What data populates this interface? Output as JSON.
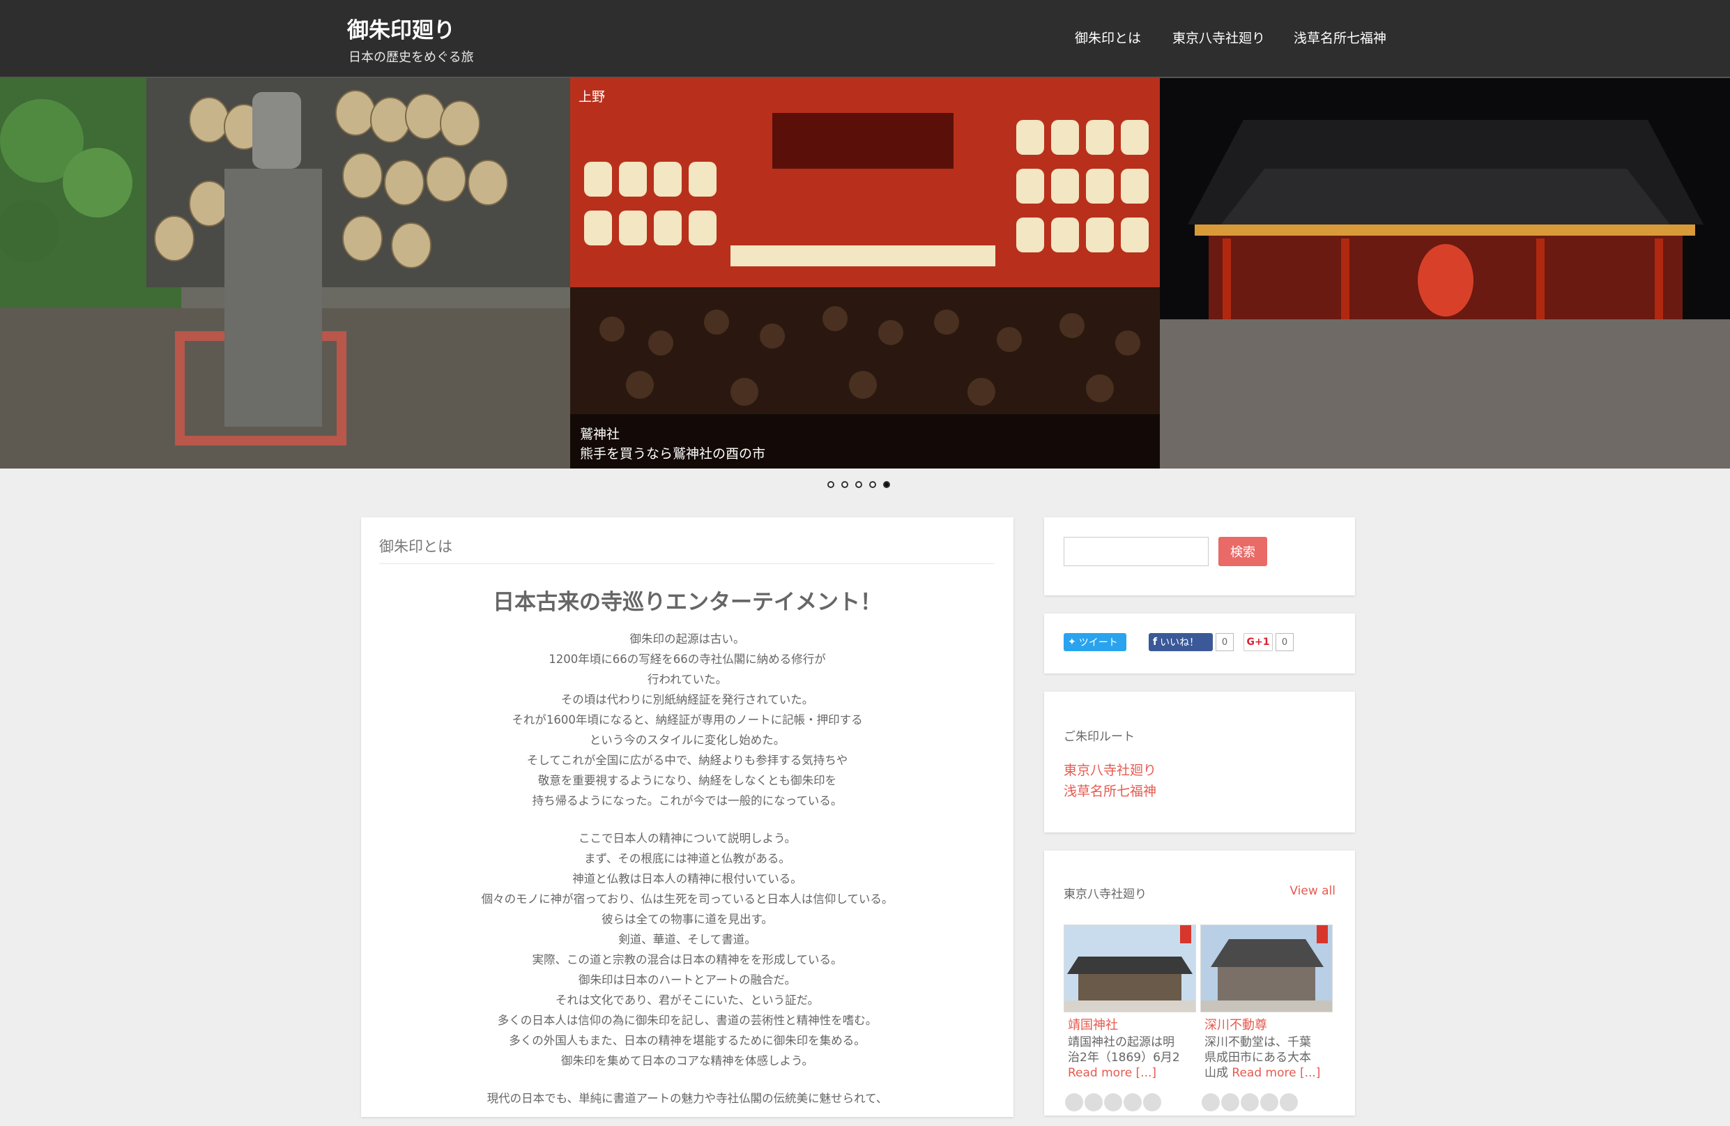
{
  "header": {
    "site_title": "御朱印廻り",
    "site_description": "日本の歴史をめぐる旅",
    "nav": [
      "御朱印とは",
      "東京八寺社廻り",
      "浅草名所七福神"
    ]
  },
  "slider": {
    "tag": "上野",
    "caption_title": "鷲神社",
    "caption_text": "熊手を買うなら鷲神社の酉の市",
    "slide_count": 5,
    "active_index": 4
  },
  "main": {
    "heading": "御朱印とは",
    "title": "日本古来の寺巡りエンターテイメント！",
    "paragraphs": [
      [
        "御朱印の起源は古い。",
        "1200年頃に66の写経を66の寺社仏閣に納める修行が",
        "行われていた。",
        "その頃は代わりに別紙納経証を発行されていた。",
        "それが1600年頃になると、納経証が専用のノートに記帳・押印する",
        "という今のスタイルに変化し始めた。",
        "そしてこれが全国に広がる中で、納経よりも参拝する気持ちや",
        "敬意を重要視するようになり、納経をしなくとも御朱印を",
        "持ち帰るようになった。これが今では一般的になっている。"
      ],
      [
        "ここで日本人の精神について説明しよう。",
        "まず、その根底には神道と仏教がある。",
        "神道と仏教は日本人の精神に根付いている。",
        "個々のモノに神が宿っており、仏は生死を司っていると日本人は信仰している。",
        "彼らは全ての物事に道を見出す。",
        "剣道、華道、そして書道。",
        "実際、この道と宗教の混合は日本の精神をを形成している。",
        "御朱印は日本のハートとアートの融合だ。",
        "それは文化であり、君がそこにいた、という証だ。",
        "多くの日本人は信仰の為に御朱印を記し、書道の芸術性と精神性を嗜む。",
        "多くの外国人もまた、日本の精神を堪能するために御朱印を集める。",
        "御朱印を集めて日本のコアな精神を体感しよう。"
      ],
      [
        "現代の日本でも、単純に書道アートの魅力や寺社仏閣の伝統美に魅せられて、"
      ]
    ]
  },
  "sidebar": {
    "search_button": "検索",
    "search_placeholder": "",
    "share": {
      "tweet": "ツイート",
      "like": "いいね！",
      "like_count": "0",
      "gplus": "G+1",
      "gplus_count": "0"
    },
    "route_widget": {
      "title": "ご朱印ルート",
      "links": [
        "東京八寺社廻り",
        "浅草名所七福神"
      ]
    },
    "posts_widget": {
      "title": "東京八寺社廻り",
      "view_all": "View all",
      "posts": [
        {
          "title": "靖国神社",
          "excerpt_line1": "靖国神社の起源は明",
          "excerpt_line2": "治2年（1869）6月2",
          "read_more": "Read more [...]",
          "stars": 5
        },
        {
          "title": "深川不動尊",
          "excerpt_line1": "深川不動堂は、千葉",
          "excerpt_line2": "県成田市にある大本",
          "excerpt_line3": "山成",
          "read_more": "Read more [...]",
          "stars": 5
        }
      ]
    }
  }
}
